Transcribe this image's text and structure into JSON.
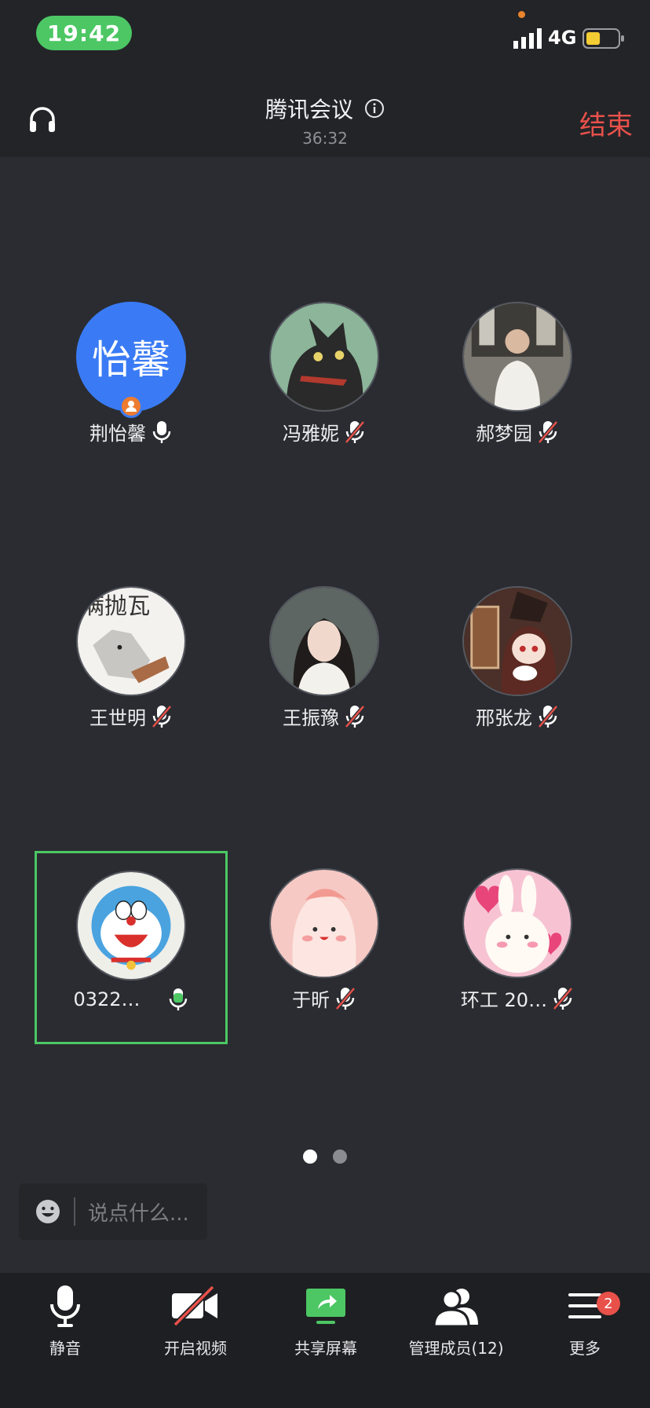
{
  "status_bar": {
    "time": "19:42",
    "network": "4G",
    "battery_level": 0.45
  },
  "header": {
    "title": "腾讯会议",
    "duration": "36:32",
    "end_label": "结束"
  },
  "participants": [
    {
      "name": "荆怡馨",
      "avatar_text": "怡馨",
      "avatar_color": "#3a7bf5",
      "mic": "on",
      "host": true
    },
    {
      "name": "冯雅妮",
      "avatar_art": "black-cat-icon",
      "mic": "muted"
    },
    {
      "name": "郝梦园",
      "avatar_art": "photo-woman-window",
      "mic": "muted"
    },
    {
      "name": "王世明",
      "avatar_art": "doge-meme",
      "mic": "muted"
    },
    {
      "name": "王振豫",
      "avatar_art": "photo-girl",
      "mic": "muted"
    },
    {
      "name": "邢张龙",
      "avatar_art": "anime-girl-hat",
      "mic": "muted"
    },
    {
      "name": "0322…",
      "avatar_art": "doraemon",
      "mic": "speaking",
      "active": true
    },
    {
      "name": "于昕",
      "avatar_art": "pink-blob",
      "mic": "muted"
    },
    {
      "name": "环工 20…",
      "avatar_art": "pink-bunny",
      "mic": "muted"
    }
  ],
  "pager": {
    "total": 2,
    "current": 1
  },
  "chat": {
    "placeholder": "说点什么..."
  },
  "toolbar": {
    "mute_label": "静音",
    "video_label": "开启视频",
    "share_label": "共享屏幕",
    "members_label": "管理成员(12)",
    "more_label": "更多",
    "more_badge": "2"
  },
  "colors": {
    "accent_green": "#4cc764",
    "end_red": "#e8514a",
    "bg": "#2a2c31"
  }
}
